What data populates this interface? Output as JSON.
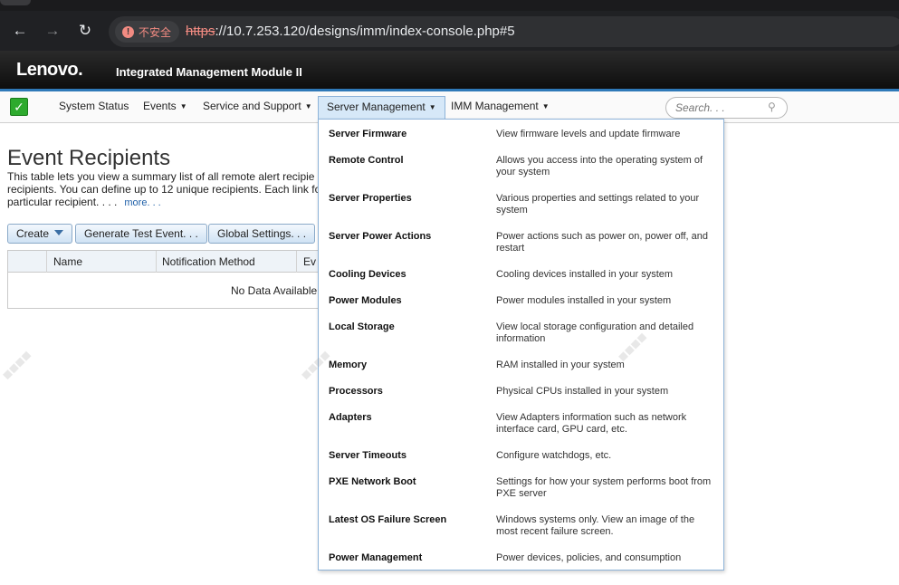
{
  "browser": {
    "security_label": "不安全",
    "url_scheme": "https",
    "url_rest": "://10.7.253.120/designs/imm/index-console.php#5"
  },
  "header": {
    "brand": "Lenovo.",
    "product": "Integrated Management Module II"
  },
  "nav": {
    "items": [
      {
        "label": "System Status",
        "dropdown": false
      },
      {
        "label": "Events",
        "dropdown": true
      },
      {
        "label": "Service and Support",
        "dropdown": true
      },
      {
        "label": "Server Management",
        "dropdown": true,
        "active": true
      },
      {
        "label": "IMM Management",
        "dropdown": true
      }
    ],
    "search_placeholder": "Search. . ."
  },
  "page": {
    "title": "Event Recipients",
    "description_lines": [
      "This table lets you view a summary list of all remote alert recipie",
      "recipients. You can define up to 12 unique recipients. Each link fo",
      "particular recipient. . . ."
    ],
    "more_link": "more. . .",
    "buttons": {
      "create": "Create",
      "generate": "Generate Test Event. . .",
      "global": "Global Settings. . ."
    },
    "table": {
      "columns": [
        "Name",
        "Notification Method",
        "Ev"
      ],
      "empty_text": "No Data Available"
    }
  },
  "menu": {
    "items": [
      {
        "title": "Server Firmware",
        "desc": "View firmware levels and update firmware"
      },
      {
        "title": "Remote Control",
        "desc": "Allows you access into the operating system of your system"
      },
      {
        "title": "Server Properties",
        "desc": "Various properties and settings related to your system"
      },
      {
        "title": "Server Power Actions",
        "desc": "Power actions such as power on, power off, and restart"
      },
      {
        "title": "Cooling Devices",
        "desc": "Cooling devices installed in your system"
      },
      {
        "title": "Power Modules",
        "desc": "Power modules installed in your system"
      },
      {
        "title": "Local Storage",
        "desc": "View local storage configuration and detailed information"
      },
      {
        "title": "Memory",
        "desc": "RAM installed in your system"
      },
      {
        "title": "Processors",
        "desc": "Physical CPUs installed in your system"
      },
      {
        "title": "Adapters",
        "desc": "View Adapters information such as network interface card, GPU card, etc."
      },
      {
        "title": "Server Timeouts",
        "desc": "Configure watchdogs, etc."
      },
      {
        "title": "PXE Network Boot",
        "desc": "Settings for how your system performs boot from PXE server"
      },
      {
        "title": "Latest OS Failure Screen",
        "desc": "Windows systems only. View an image of the most recent failure screen."
      },
      {
        "title": "Power Management",
        "desc": "Power devices, policies, and consumption"
      }
    ]
  },
  "colors": {
    "accent": "#2f79b8",
    "active_tab": "#d6e8f8",
    "status_ok": "#2eaa2e"
  }
}
